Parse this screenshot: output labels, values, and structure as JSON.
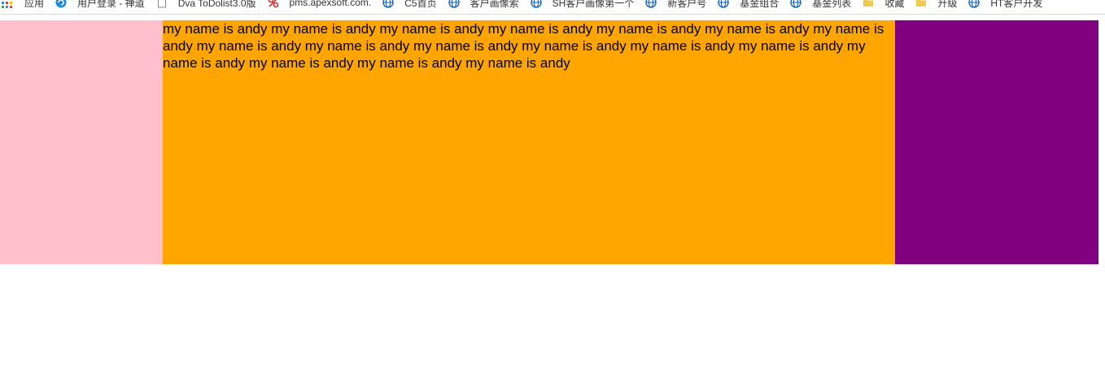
{
  "bookmarks": {
    "apps_label": "应用",
    "items": [
      {
        "label": "用户登录 - 禅道",
        "icon": "chandao-icon",
        "color": "#1e88e5"
      },
      {
        "label": "Dva ToDolist3.0版",
        "icon": "page-icon",
        "color": "#888888"
      },
      {
        "label": "pms.apexsoft.com.",
        "icon": "apexsoft-icon",
        "color": "#d32f2f"
      },
      {
        "label": "C5首页",
        "icon": "globe-icon",
        "color": "#1565c0"
      },
      {
        "label": "客户画像索",
        "icon": "globe-icon",
        "color": "#1565c0"
      },
      {
        "label": "SH客户画像第一个",
        "icon": "globe-icon",
        "color": "#1565c0"
      },
      {
        "label": "新客户号",
        "icon": "globe-icon",
        "color": "#1565c0"
      },
      {
        "label": "基金组合",
        "icon": "globe-icon",
        "color": "#1565c0"
      },
      {
        "label": "基金列表",
        "icon": "globe-icon",
        "color": "#1565c0"
      },
      {
        "label": "收藏",
        "icon": "folder-icon",
        "color": "#f2c94c"
      },
      {
        "label": "升级",
        "icon": "folder-icon",
        "color": "#f2c94c"
      },
      {
        "label": "HT客户开发",
        "icon": "globe-icon",
        "color": "#1565c0"
      }
    ]
  },
  "layout": {
    "left_color": "#ffc0cb",
    "center_color": "#ffa500",
    "right_color": "#800080"
  },
  "center": {
    "text": "my name is andy my name is andy my name is andy my name is andy my name is andy my name is andy my name is andy my name is andy my name is andy my name is andy my name is andy my name is andy my name is andy my name is andy my name is andy my name is andy my name is andy"
  }
}
